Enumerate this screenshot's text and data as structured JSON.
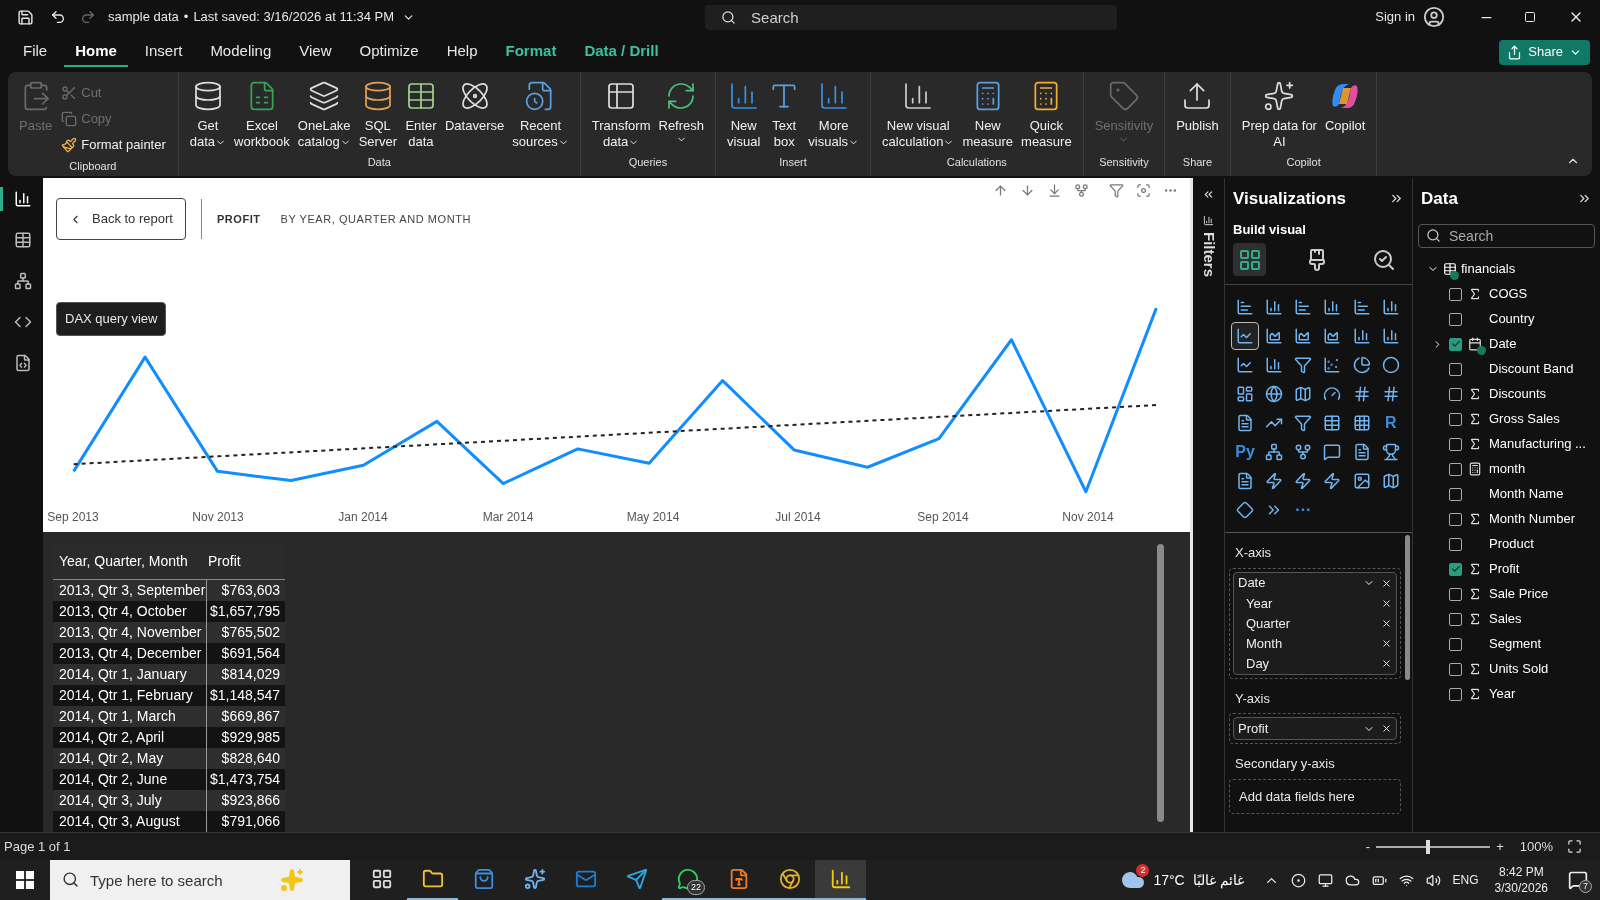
{
  "title_bar": {
    "file_name": "sample data",
    "separator": "•",
    "last_saved": "Last saved: 3/16/2026 at 11:34 PM",
    "redo_disabled": true,
    "search": {
      "placeholder": "Search"
    },
    "sign_in": "Sign in"
  },
  "menu_tabs": [
    {
      "label": "File",
      "selected": false,
      "contextual": false
    },
    {
      "label": "Home",
      "selected": true,
      "contextual": false
    },
    {
      "label": "Insert",
      "selected": false,
      "contextual": false
    },
    {
      "label": "Modeling",
      "selected": false,
      "contextual": false
    },
    {
      "label": "View",
      "selected": false,
      "contextual": false
    },
    {
      "label": "Optimize",
      "selected": false,
      "contextual": false
    },
    {
      "label": "Help",
      "selected": false,
      "contextual": false
    },
    {
      "label": "Format",
      "selected": false,
      "contextual": true
    },
    {
      "label": "Data / Drill",
      "selected": false,
      "contextual": true
    }
  ],
  "share_button": "Share",
  "ribbon": [
    {
      "group": "Clipboard",
      "buttons": [
        {
          "kind": "large",
          "lines": [
            "Paste"
          ],
          "disabled": true
        },
        {
          "kind": "small",
          "lines": [
            "Cut"
          ],
          "disabled": true
        },
        {
          "kind": "small",
          "lines": [
            "Copy"
          ],
          "disabled": true
        },
        {
          "kind": "small",
          "lines": [
            "Format painter"
          ],
          "disabled": false
        }
      ]
    },
    {
      "group": "Data",
      "buttons": [
        {
          "kind": "large",
          "lines": [
            "Get",
            "data"
          ],
          "dropdown": true,
          "disabled": false
        },
        {
          "kind": "large",
          "lines": [
            "Excel",
            "workbook"
          ],
          "disabled": false
        },
        {
          "kind": "large",
          "lines": [
            "OneLake",
            "catalog"
          ],
          "dropdown": true,
          "disabled": false
        },
        {
          "kind": "large",
          "lines": [
            "SQL",
            "Server"
          ],
          "disabled": false
        },
        {
          "kind": "large",
          "lines": [
            "Enter",
            "data"
          ],
          "disabled": false
        },
        {
          "kind": "large",
          "lines": [
            "Dataverse"
          ],
          "disabled": false
        },
        {
          "kind": "large",
          "lines": [
            "Recent",
            "sources"
          ],
          "dropdown": true,
          "disabled": false
        }
      ]
    },
    {
      "group": "Queries",
      "buttons": [
        {
          "kind": "large",
          "lines": [
            "Transform",
            "data"
          ],
          "dropdown": true,
          "disabled": false
        },
        {
          "kind": "large",
          "lines": [
            "Refresh"
          ],
          "dropdown": true,
          "disabled": false
        }
      ]
    },
    {
      "group": "Insert",
      "buttons": [
        {
          "kind": "large",
          "lines": [
            "New",
            "visual"
          ],
          "disabled": false
        },
        {
          "kind": "large",
          "lines": [
            "Text",
            "box"
          ],
          "disabled": false
        },
        {
          "kind": "large",
          "lines": [
            "More",
            "visuals"
          ],
          "dropdown": true,
          "disabled": false
        }
      ]
    },
    {
      "group": "Calculations",
      "buttons": [
        {
          "kind": "large",
          "lines": [
            "New visual",
            "calculation"
          ],
          "dropdown": true,
          "disabled": false
        },
        {
          "kind": "large",
          "lines": [
            "New",
            "measure"
          ],
          "disabled": false
        },
        {
          "kind": "large",
          "lines": [
            "Quick",
            "measure"
          ],
          "disabled": false
        }
      ]
    },
    {
      "group": "Sensitivity",
      "buttons": [
        {
          "kind": "large",
          "lines": [
            "Sensitivity"
          ],
          "dropdown": true,
          "disabled": true
        }
      ]
    },
    {
      "group": "Share",
      "buttons": [
        {
          "kind": "large",
          "lines": [
            "Publish"
          ],
          "disabled": false
        }
      ]
    },
    {
      "group": "Copilot",
      "buttons": [
        {
          "kind": "large",
          "lines": [
            "Prep data for",
            "AI"
          ],
          "disabled": false
        },
        {
          "kind": "large",
          "lines": [
            "Copilot"
          ],
          "disabled": false
        }
      ]
    }
  ],
  "nav_rail": [
    {
      "selected": true
    },
    {
      "selected": false
    },
    {
      "selected": false
    },
    {
      "selected": false
    },
    {
      "selected": false
    }
  ],
  "nav_tooltip": "DAX query view",
  "canvas": {
    "back_button": "Back to report",
    "title": "PROFIT",
    "subtitle": "BY YEAR, QUARTER AND MONTH",
    "x_labels": [
      "Sep 2013",
      "Nov 2013",
      "Jan 2014",
      "Mar 2014",
      "May 2014",
      "Jul 2014",
      "Sep 2014",
      "Nov 2014"
    ],
    "table": {
      "columns": [
        "Year, Quarter, Month",
        "Profit"
      ],
      "rows": [
        [
          "2013, Qtr 3, September",
          "$763,603"
        ],
        [
          "2013, Qtr 4, October",
          "$1,657,795"
        ],
        [
          "2013, Qtr 4, November",
          "$765,502"
        ],
        [
          "2013, Qtr 4, December",
          "$691,564"
        ],
        [
          "2014, Qtr 1, January",
          "$814,029"
        ],
        [
          "2014, Qtr 1, February",
          "$1,148,547"
        ],
        [
          "2014, Qtr 1, March",
          "$669,867"
        ],
        [
          "2014, Qtr 2, April",
          "$929,985"
        ],
        [
          "2014, Qtr 2, May",
          "$828,640"
        ],
        [
          "2014, Qtr 2, June",
          "$1,473,754"
        ],
        [
          "2014, Qtr 3, July",
          "$923,866"
        ],
        [
          "2014, Qtr 3, August",
          "$791,066"
        ]
      ]
    }
  },
  "filters_pane": {
    "label": "Filters"
  },
  "visualizations": {
    "title": "Visualizations",
    "subtitle": "Build visual",
    "tabs": [
      {
        "selected": true
      },
      {
        "selected": false
      },
      {
        "selected": false
      }
    ],
    "visual_types": [
      {
        "selected": false
      },
      {
        "selected": false
      },
      {
        "selected": false
      },
      {
        "selected": false
      },
      {
        "selected": false
      },
      {
        "selected": false
      },
      {
        "selected": true
      },
      {
        "selected": false
      },
      {
        "selected": false
      },
      {
        "selected": false
      },
      {
        "selected": false
      },
      {
        "selected": false
      },
      {
        "selected": false
      },
      {
        "selected": false
      },
      {
        "selected": false
      },
      {
        "selected": false
      },
      {
        "selected": false
      },
      {
        "selected": false
      },
      {
        "selected": false
      },
      {
        "selected": false
      },
      {
        "selected": false
      },
      {
        "selected": false
      },
      {
        "selected": false
      },
      {
        "selected": false
      },
      {
        "selected": false
      },
      {
        "selected": false
      },
      {
        "selected": false
      },
      {
        "selected": false
      },
      {
        "selected": false
      },
      {
        "selected": false,
        "label": "R"
      },
      {
        "selected": false,
        "label": "Py"
      },
      {
        "selected": false
      },
      {
        "selected": false
      },
      {
        "selected": false
      },
      {
        "selected": false
      },
      {
        "selected": false
      },
      {
        "selected": false
      },
      {
        "selected": false
      },
      {
        "selected": false
      },
      {
        "selected": false
      },
      {
        "selected": false
      },
      {
        "selected": false
      },
      {
        "selected": false
      },
      {
        "selected": false
      },
      {
        "selected": false,
        "label": "···"
      }
    ],
    "wells": [
      {
        "label": "X-axis",
        "fields": [
          {
            "name": "Date",
            "children": [
              {
                "name": "Year"
              },
              {
                "name": "Quarter"
              },
              {
                "name": "Month"
              },
              {
                "name": "Day"
              }
            ]
          }
        ]
      },
      {
        "label": "Y-axis",
        "fields": [
          {
            "name": "Profit"
          }
        ]
      },
      {
        "label": "Secondary y-axis",
        "placeholder": "Add data fields here"
      }
    ]
  },
  "data_pane": {
    "title": "Data",
    "search": {
      "placeholder": "Search"
    },
    "tables": [
      {
        "name": "financials",
        "expanded": true,
        "fields": [
          {
            "name": "COGS",
            "kind": "measure",
            "checked": false
          },
          {
            "name": "Country",
            "kind": "text",
            "checked": false
          },
          {
            "name": "Date",
            "kind": "hierarchy",
            "checked": true,
            "expanded": false
          },
          {
            "name": "Discount Band",
            "kind": "text",
            "checked": false
          },
          {
            "name": "Discounts",
            "kind": "measure",
            "checked": false
          },
          {
            "name": "Gross Sales",
            "kind": "measure",
            "checked": false
          },
          {
            "name": "Manufacturing ...",
            "kind": "measure",
            "checked": false
          },
          {
            "name": "month",
            "kind": "calculated",
            "checked": false
          },
          {
            "name": "Month Name",
            "kind": "text",
            "checked": false
          },
          {
            "name": "Month Number",
            "kind": "measure",
            "checked": false
          },
          {
            "name": "Product",
            "kind": "text",
            "checked": false
          },
          {
            "name": "Profit",
            "kind": "measure",
            "checked": true
          },
          {
            "name": "Sale Price",
            "kind": "measure",
            "checked": false
          },
          {
            "name": "Sales",
            "kind": "measure",
            "checked": false
          },
          {
            "name": "Segment",
            "kind": "text",
            "checked": false
          },
          {
            "name": "Units Sold",
            "kind": "measure",
            "checked": false
          },
          {
            "name": "Year",
            "kind": "measure",
            "checked": false
          }
        ]
      }
    ]
  },
  "status_bar": {
    "page": "Page 1 of 1",
    "zoom_out": "-",
    "zoom_in": "+",
    "zoom_slider": {
      "level": 0.45
    },
    "zoom": "100%"
  },
  "taskbar": {
    "search": {
      "placeholder": "Type here to search"
    },
    "apps": [
      {
        "running": false,
        "selected": false
      },
      {
        "running": true,
        "selected": false
      },
      {
        "running": false,
        "selected": false
      },
      {
        "running": false,
        "selected": false
      },
      {
        "running": false,
        "selected": false
      },
      {
        "running": false,
        "selected": false
      },
      {
        "running": true,
        "selected": false,
        "badge": "22"
      },
      {
        "running": true,
        "selected": false
      },
      {
        "running": true,
        "selected": false
      },
      {
        "running": true,
        "selected": true
      }
    ],
    "weather": {
      "badge": "2",
      "temperature": "17°C",
      "condition": "غائم غالبًا"
    },
    "language": "ENG",
    "time": "8:42 PM",
    "date": "3/30/2026",
    "notifications": "7"
  }
}
